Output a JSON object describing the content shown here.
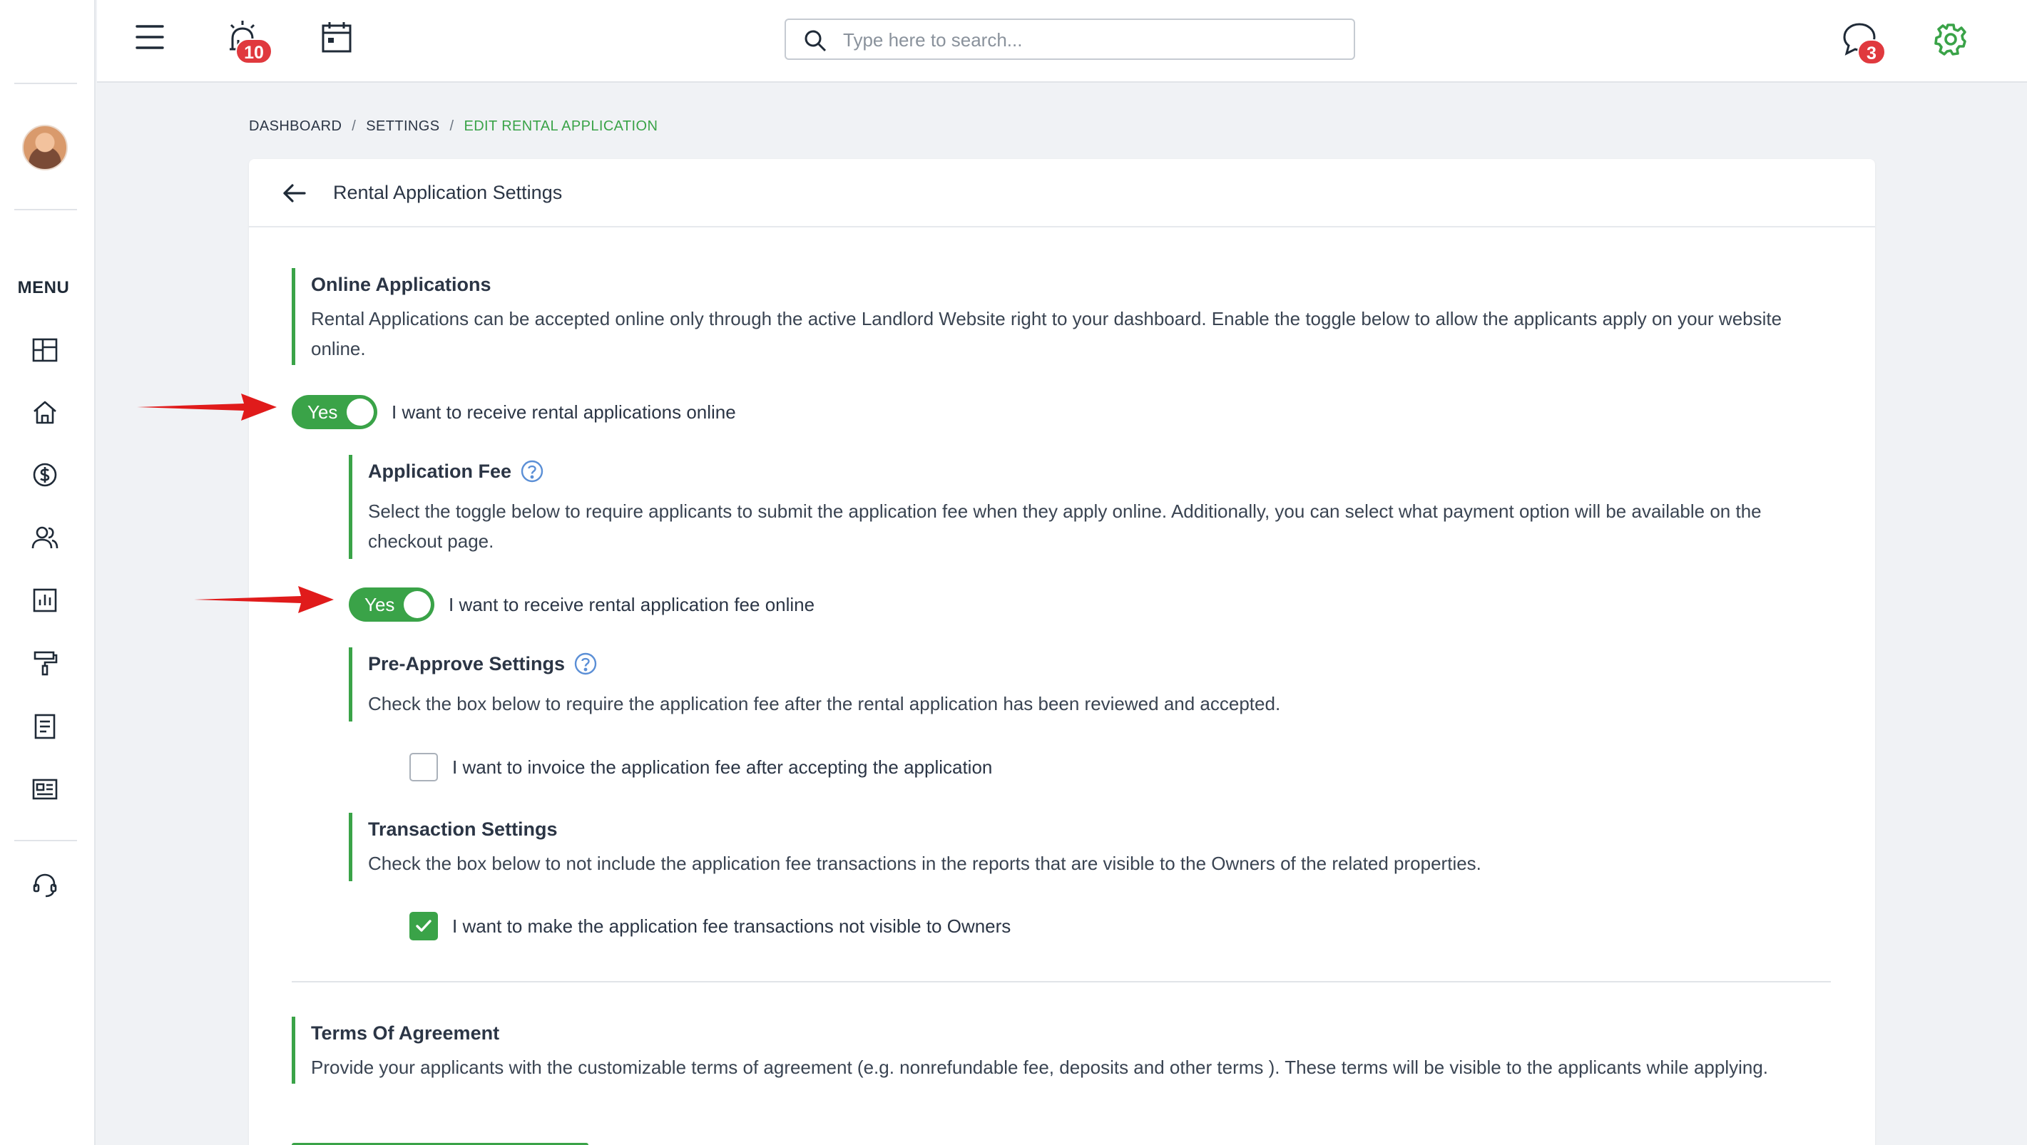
{
  "sidebar": {
    "menu_label": "MENU"
  },
  "topbar": {
    "alarm_badge": "10",
    "chat_badge": "3",
    "search": {
      "placeholder": "Type here to search..."
    }
  },
  "breadcrumb": {
    "items": [
      "DASHBOARD",
      "SETTINGS",
      "EDIT RENTAL APPLICATION"
    ]
  },
  "page": {
    "title": "Rental Application Settings"
  },
  "online_applications": {
    "title": "Online Applications",
    "description": "Rental Applications can be accepted online only through the active Landlord Website right to your dashboard. Enable the toggle below to allow the applicants apply on your website online.",
    "toggle_state": "Yes",
    "toggle_label": "I want to receive rental applications online"
  },
  "application_fee": {
    "title": "Application Fee",
    "description": "Select the toggle below to require applicants to submit the application fee when they apply online. Additionally, you can select what payment option will be available on the checkout page.",
    "toggle_state": "Yes",
    "toggle_label": "I want to receive rental application fee online"
  },
  "pre_approve": {
    "title": "Pre-Approve Settings",
    "description": "Check the box below to require the application fee after the rental application has been reviewed and accepted.",
    "checkbox_label": "I want to invoice the application fee after accepting the application",
    "checked": false
  },
  "transaction": {
    "title": "Transaction Settings",
    "description": "Check the box below to not include the application fee transactions in the reports that are visible to the Owners of the related properties.",
    "checkbox_label": "I want to make the application fee transactions not visible to Owners",
    "checked": true
  },
  "terms": {
    "title": "Terms Of Agreement",
    "description": "Provide your applicants with the customizable terms of agreement (e.g. nonrefundable fee, deposits and other terms ). These terms will be visible to the applicants while applying."
  },
  "colors": {
    "accent": "#3aa348",
    "badge": "#e0393e",
    "annotation_arrow": "#e01b1b"
  }
}
